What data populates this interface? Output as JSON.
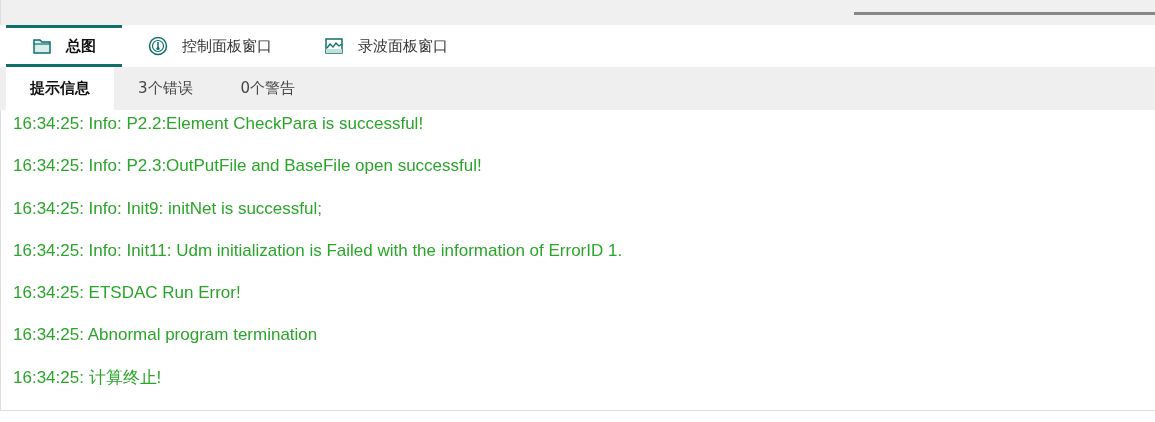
{
  "tabs": [
    {
      "label": "总图",
      "kind": "folder",
      "selected": true
    },
    {
      "label": "控制面板窗口",
      "kind": "gauge",
      "selected": false
    },
    {
      "label": "录波面板窗口",
      "kind": "wave",
      "selected": false
    }
  ],
  "subtabs": [
    {
      "label": "提示信息",
      "selected": true
    },
    {
      "label": "3个错误",
      "selected": false
    },
    {
      "label": "0个警告",
      "selected": false
    }
  ],
  "messages": [
    "16:34:25: Info: P2.2:Element CheckPara is successful!",
    "16:34:25: Info: P2.3:OutPutFile and BaseFile open successful!",
    "16:34:25: Info: Init9: initNet is successful;",
    "16:34:25: Info: Init11: Udm initialization is Failed with the information of ErrorID 1.",
    "16:34:25: ETSDAC Run Error!",
    "16:34:25: Abnormal program termination",
    "16:34:25: 计算终止!"
  ]
}
